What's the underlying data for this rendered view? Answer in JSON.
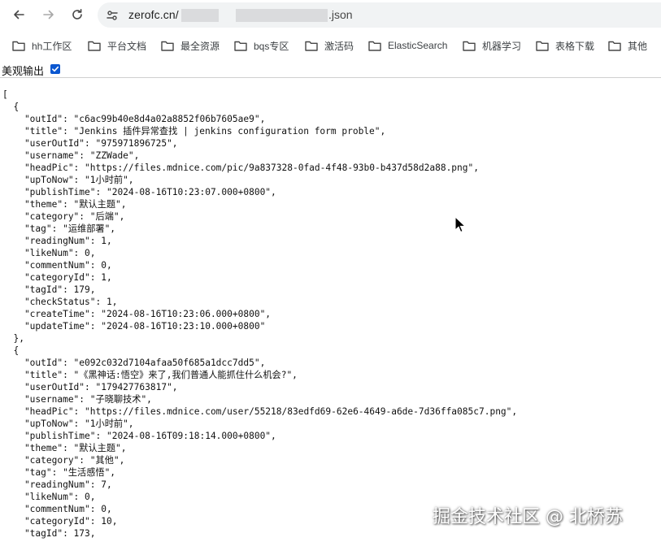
{
  "browser": {
    "url_host": "zerofc.cn/",
    "url_suffix": ".json",
    "icons": [
      "back-arrow-icon",
      "forward-arrow-icon",
      "reload-icon",
      "site-info-icon"
    ]
  },
  "bookmarks": [
    {
      "label": "hh工作区"
    },
    {
      "label": "平台文档"
    },
    {
      "label": "最全资源"
    },
    {
      "label": "bqs专区"
    },
    {
      "label": "激活码"
    },
    {
      "label": "ElasticSearch"
    },
    {
      "label": "机器学习"
    },
    {
      "label": "表格下载"
    },
    {
      "label": "其他"
    }
  ],
  "viewer": {
    "pretty_print_label": "美观输出",
    "pretty_print_checked": true
  },
  "json_lines": [
    "[",
    "  {",
    "    \"outId\": \"c6ac99b40e8d4a02a8852f06b7605ae9\",",
    "    \"title\": \"Jenkins 插件异常查找 | jenkins configuration form proble\",",
    "    \"userOutId\": \"975971896725\",",
    "    \"username\": \"ZZWade\",",
    "    \"headPic\": \"https://files.mdnice.com/pic/9a837328-0fad-4f48-93b0-b437d58d2a88.png\",",
    "    \"upToNow\": \"1小时前\",",
    "    \"publishTime\": \"2024-08-16T10:23:07.000+0800\",",
    "    \"theme\": \"默认主题\",",
    "    \"category\": \"后端\",",
    "    \"tag\": \"运维部署\",",
    "    \"readingNum\": 1,",
    "    \"likeNum\": 0,",
    "    \"commentNum\": 0,",
    "    \"categoryId\": 1,",
    "    \"tagId\": 179,",
    "    \"checkStatus\": 1,",
    "    \"createTime\": \"2024-08-16T10:23:06.000+0800\",",
    "    \"updateTime\": \"2024-08-16T10:23:10.000+0800\"",
    "  },",
    "  {",
    "    \"outId\": \"e092c032d7104afaa50f685a1dcc7dd5\",",
    "    \"title\": \"《黑神话:悟空》来了,我们普通人能抓住什么机会?\",",
    "    \"userOutId\": \"179427763817\",",
    "    \"username\": \"子晓聊技术\",",
    "    \"headPic\": \"https://files.mdnice.com/user/55218/83edfd69-62e6-4649-a6de-7d36ffa085c7.png\",",
    "    \"upToNow\": \"1小时前\",",
    "    \"publishTime\": \"2024-08-16T09:18:14.000+0800\",",
    "    \"theme\": \"默认主题\",",
    "    \"category\": \"其他\",",
    "    \"tag\": \"生活感悟\",",
    "    \"readingNum\": 7,",
    "    \"likeNum\": 0,",
    "    \"commentNum\": 0,",
    "    \"categoryId\": 10,",
    "    \"tagId\": 173,"
  ],
  "watermark": "掘金技术社区 @ 北桥苏",
  "colors": {
    "omnibox_bg": "#f1f3f4",
    "checkbox_accent": "#0b57d0",
    "text": "#1f1f1f"
  }
}
